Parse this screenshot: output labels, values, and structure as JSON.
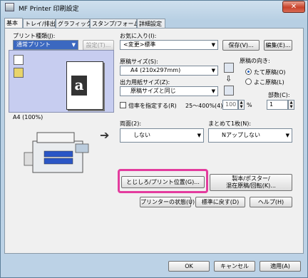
{
  "window": {
    "title": "MF Printer 印刷設定",
    "close_label": "✕"
  },
  "tabs": [
    "基本",
    "トレイ/排出",
    "グラフィックス",
    "スタンプ/フォーム",
    "詳細設定"
  ],
  "left": {
    "print_type_label": "プリント種類(J):",
    "print_type_value": "通常プリント",
    "settings_button": "設定(T)...",
    "preview_caption": "A4 (100%)"
  },
  "favorites": {
    "label": "お気に入り(I):",
    "value": "<変更>標準",
    "save_button": "保存(V)...",
    "edit_button": "編集(E)..."
  },
  "paper": {
    "size_label": "原稿サイズ(S):",
    "size_value": "A4 (210x297mm)",
    "output_label": "出力用紙サイズ(Z):",
    "output_value": "原稿サイズと同じ",
    "zoom_checkbox_label": "倍率を指定する(R)",
    "zoom_range": "25～400%(4):",
    "zoom_value": "100",
    "zoom_unit": "%"
  },
  "orientation": {
    "label": "原稿の向き:",
    "portrait": "たて原稿(O)",
    "landscape": "よこ原稿(L)"
  },
  "copies": {
    "label": "部数(C):",
    "value": "1"
  },
  "duplex": {
    "label": "両面(2):",
    "value": "しない"
  },
  "nup": {
    "label": "まとめて1枚(N):",
    "value": "Nアップしない"
  },
  "buttons": {
    "binding": "とじしろ/プリント位置(G)...",
    "booklet_line1": "製本/ポスター/",
    "booklet_line2": "混在原稿/回転(K)...",
    "printer_status": "プリンターの状態(U)",
    "restore_default": "標準に戻す(D)",
    "help": "ヘルプ(H)"
  },
  "footer": {
    "ok": "OK",
    "cancel": "キャンセル",
    "apply": "適用(A)"
  }
}
